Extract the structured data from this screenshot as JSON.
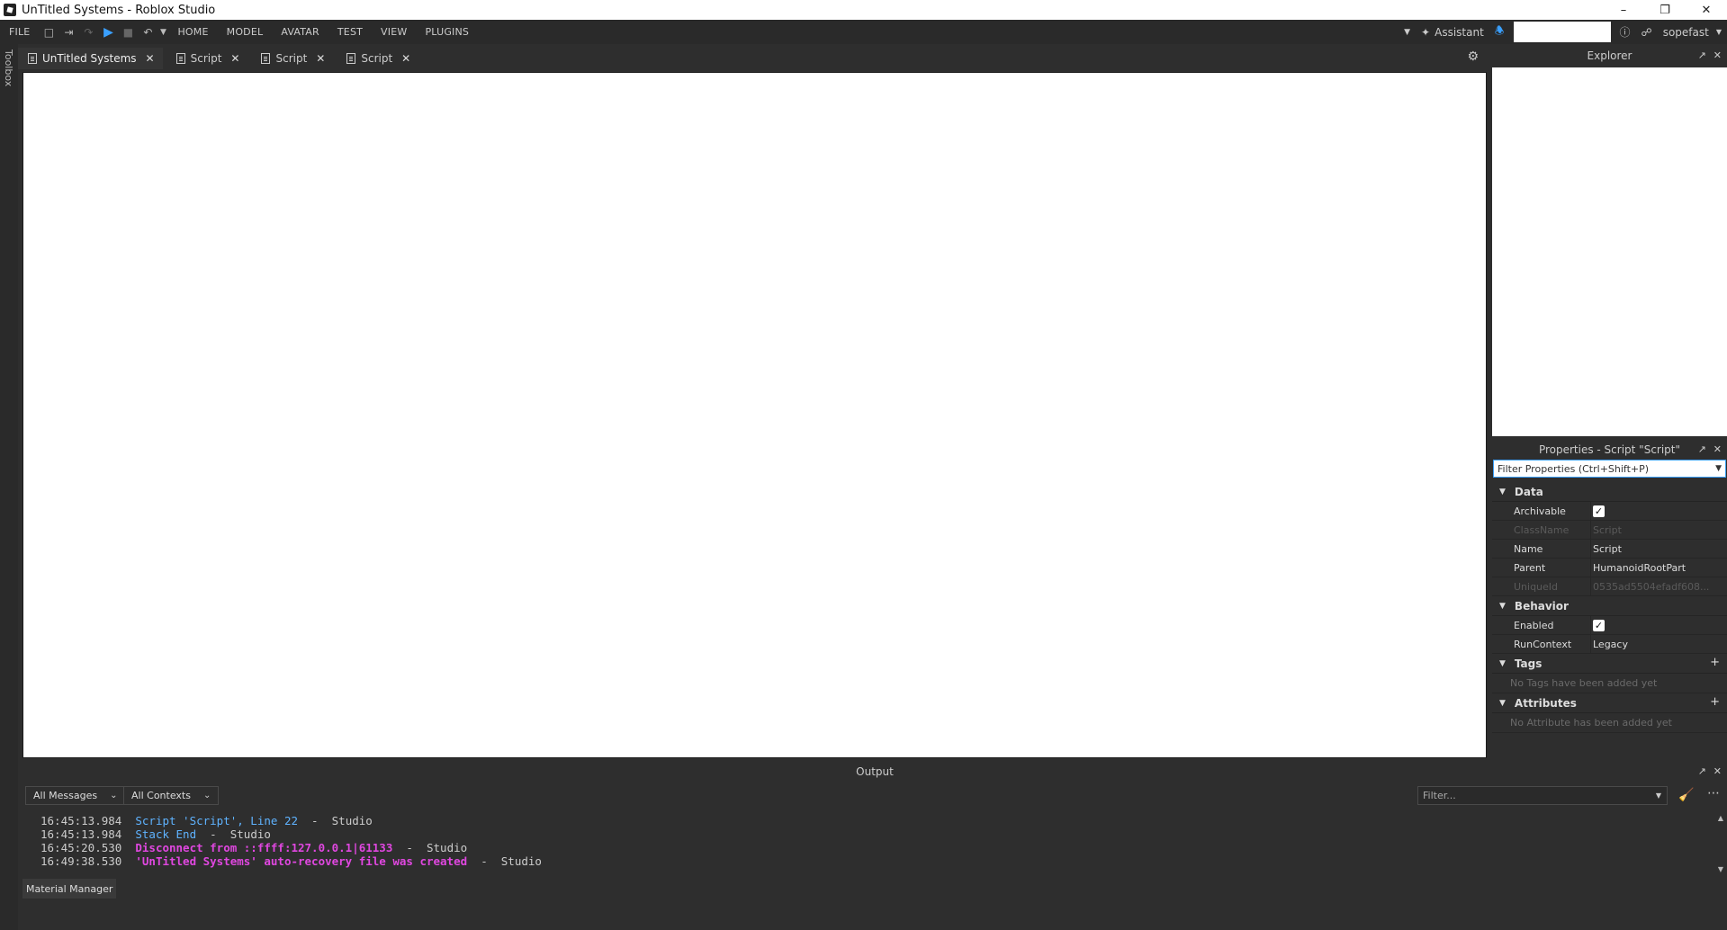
{
  "window": {
    "title": "UnTitled Systems - Roblox Studio",
    "controls": [
      "–",
      "❐",
      "✕"
    ]
  },
  "menubar": {
    "file": "FILE",
    "tabs": [
      "HOME",
      "MODEL",
      "AVATAR",
      "TEST",
      "VIEW",
      "PLUGINS"
    ],
    "assistant": "Assistant",
    "user": "sopefast"
  },
  "toolbox": {
    "label": "Toolbox"
  },
  "doc_tabs": [
    {
      "label": "UnTitled Systems",
      "close": "✕"
    },
    {
      "label": "Script",
      "close": "✕"
    },
    {
      "label": "Script",
      "close": "✕"
    },
    {
      "label": "Script",
      "close": "✕"
    }
  ],
  "explorer": {
    "title": "Explorer"
  },
  "properties": {
    "title": "Properties - Script \"Script\"",
    "filter_placeholder": "Filter Properties (Ctrl+Shift+P)",
    "sections": {
      "data": "Data",
      "behavior": "Behavior",
      "tags": "Tags",
      "attributes": "Attributes"
    },
    "rows": {
      "archivable": {
        "name": "Archivable",
        "checked": true
      },
      "classname": {
        "name": "ClassName",
        "value": "Script"
      },
      "name": {
        "name": "Name",
        "value": "Script"
      },
      "parent": {
        "name": "Parent",
        "value": "HumanoidRootPart"
      },
      "uniqueid": {
        "name": "UniqueId",
        "value": "0535ad5504efadf608..."
      },
      "enabled": {
        "name": "Enabled",
        "checked": true
      },
      "runcontext": {
        "name": "RunContext",
        "value": "Legacy"
      }
    },
    "tags_empty": "No Tags have been added yet",
    "attributes_empty": "No Attribute has been added yet"
  },
  "output": {
    "title": "Output",
    "messages_filter": "All Messages",
    "contexts_filter": "All Contexts",
    "filter_placeholder": "Filter...",
    "lines": [
      {
        "ts": "16:45:13.984",
        "msg": "Script 'Script', Line 22",
        "sep": "  -  ",
        "src": "Studio"
      },
      {
        "ts": "16:45:13.984",
        "msg": "Stack End",
        "sep": "  -  ",
        "src": "Studio"
      },
      {
        "ts": "16:45:20.530",
        "msg": "Disconnect from ::ffff:127.0.0.1|61133",
        "sep": "  -  ",
        "src": "Studio"
      },
      {
        "ts": "16:49:38.530",
        "msg": "'UnTitled Systems' auto-recovery file was created",
        "sep": "  -  ",
        "src": "Studio"
      }
    ]
  },
  "material_manager": "Material Manager",
  "colors": {
    "accent": "#3aa0ff",
    "log_info": "#5fb3ff",
    "log_warn": "#e047e0",
    "panel_bg": "#2e2e2e"
  }
}
